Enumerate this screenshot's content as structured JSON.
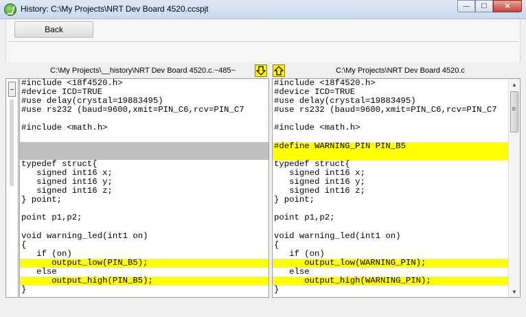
{
  "window": {
    "title": "History: C:\\My Projects\\NRT Dev Board 4520.ccspjt",
    "minimize_glyph": "—",
    "maximize_glyph": "☐",
    "close_glyph": "✕"
  },
  "toolbar": {
    "back_label": "Back"
  },
  "left_pane": {
    "header": "C:\\My Projects\\__history\\NRT Dev Board 4520.c.~485~",
    "arrow": "arrow-down-icon",
    "lines": [
      {
        "text": "#include <18f4520.h>",
        "hl": ""
      },
      {
        "text": "#device ICD=TRUE",
        "hl": ""
      },
      {
        "text": "#use delay(crystal=19883495)",
        "hl": ""
      },
      {
        "text": "#use rs232 (baud=9600,xmit=PIN_C6,rcv=PIN_C7",
        "hl": ""
      },
      {
        "text": "",
        "hl": ""
      },
      {
        "text": "#include <math.h>",
        "hl": ""
      },
      {
        "text": "",
        "hl": ""
      },
      {
        "text": "",
        "hl": "gray"
      },
      {
        "text": "",
        "hl": "gray"
      },
      {
        "text": "typedef struct{",
        "hl": ""
      },
      {
        "text": "   signed int16 x;",
        "hl": ""
      },
      {
        "text": "   signed int16 y;",
        "hl": ""
      },
      {
        "text": "   signed int16 z;",
        "hl": ""
      },
      {
        "text": "} point;",
        "hl": ""
      },
      {
        "text": "",
        "hl": ""
      },
      {
        "text": "point p1,p2;",
        "hl": ""
      },
      {
        "text": "",
        "hl": ""
      },
      {
        "text": "void warning_led(int1 on)",
        "hl": ""
      },
      {
        "text": "{",
        "hl": ""
      },
      {
        "text": "   if (on)",
        "hl": ""
      },
      {
        "text": "      output_low(PIN_B5);",
        "hl": "yellow"
      },
      {
        "text": "   else",
        "hl": ""
      },
      {
        "text": "      output_high(PIN_B5);",
        "hl": "yellow"
      },
      {
        "text": "}",
        "hl": ""
      }
    ]
  },
  "right_pane": {
    "header": "C:\\My Projects\\NRT Dev Board 4520.c",
    "arrow": "arrow-up-icon",
    "lines": [
      {
        "text": "#include <18f4520.h>",
        "hl": ""
      },
      {
        "text": "#device ICD=TRUE",
        "hl": ""
      },
      {
        "text": "#use delay(crystal=19883495)",
        "hl": ""
      },
      {
        "text": "#use rs232 (baud=9600,xmit=PIN_C6,rcv=PIN_C7",
        "hl": ""
      },
      {
        "text": "",
        "hl": ""
      },
      {
        "text": "#include <math.h>",
        "hl": ""
      },
      {
        "text": "",
        "hl": ""
      },
      {
        "text": "#define WARNING_PIN PIN_B5",
        "hl": "yellow"
      },
      {
        "text": "",
        "hl": "yellow"
      },
      {
        "text": "typedef struct{",
        "hl": ""
      },
      {
        "text": "   signed int16 x;",
        "hl": ""
      },
      {
        "text": "   signed int16 y;",
        "hl": ""
      },
      {
        "text": "   signed int16 z;",
        "hl": ""
      },
      {
        "text": "} point;",
        "hl": ""
      },
      {
        "text": "",
        "hl": ""
      },
      {
        "text": "point p1,p2;",
        "hl": ""
      },
      {
        "text": "",
        "hl": ""
      },
      {
        "text": "void warning_led(int1 on)",
        "hl": ""
      },
      {
        "text": "{",
        "hl": ""
      },
      {
        "text": "   if (on)",
        "hl": ""
      },
      {
        "text": "      output_low(WARNING_PIN);",
        "hl": "yellow"
      },
      {
        "text": "   else",
        "hl": ""
      },
      {
        "text": "      output_high(WARNING_PIN);",
        "hl": "yellow"
      },
      {
        "text": "}",
        "hl": ""
      }
    ]
  },
  "colors": {
    "change_highlight": "#ffff00",
    "removed_highlight": "#c0c0c0"
  }
}
